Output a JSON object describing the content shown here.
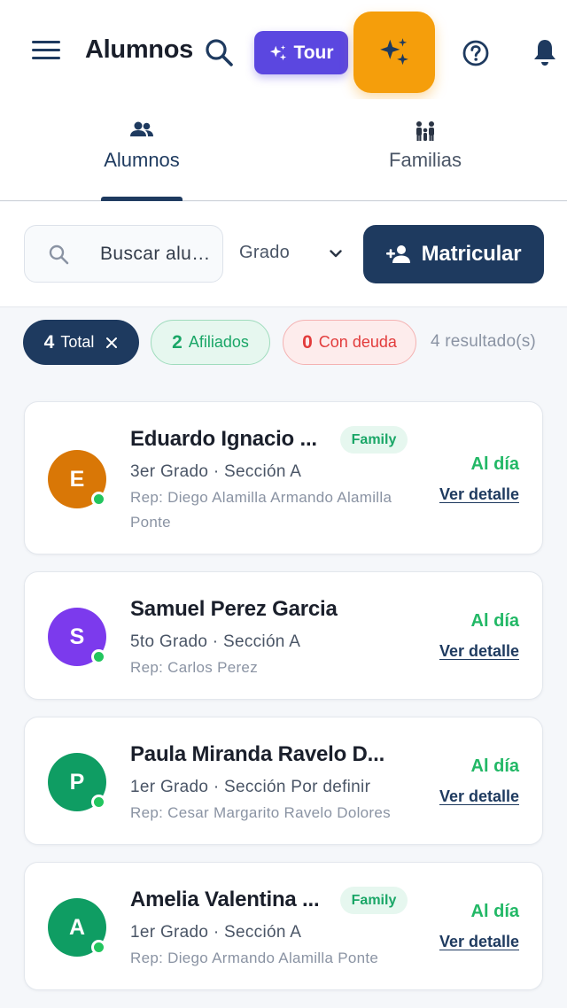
{
  "header": {
    "title": "Alumnos",
    "tour_label": "Tour",
    "icons": [
      "menu-icon",
      "search-icon",
      "sparkles-icon",
      "help-icon",
      "bell-icon"
    ]
  },
  "tabs": [
    {
      "label": "Alumnos",
      "icon": "users-icon",
      "active": true
    },
    {
      "label": "Familias",
      "icon": "family-icon",
      "active": false
    }
  ],
  "filters": {
    "search_placeholder": "Buscar alu…",
    "grade_label": "Grado",
    "enroll_label": "Matricular"
  },
  "chips": {
    "total": {
      "count": "4",
      "label": "Total"
    },
    "afiliados": {
      "count": "2",
      "label": "Afiliados"
    },
    "deuda": {
      "count": "0",
      "label": "Con deuda"
    }
  },
  "results_text": "4 resultado(s)",
  "students": [
    {
      "initial": "E",
      "name": "Eduardo Ignacio ...",
      "badge": "Family",
      "grade": "3er Grado · Sección A",
      "rep": "Rep: Diego Alamilla Armando Alamilla Ponte",
      "status": "Al día",
      "detail": "Ver detalle",
      "avatar_color": "#d97706"
    },
    {
      "initial": "S",
      "name": "Samuel Perez Garcia",
      "badge": "",
      "grade": "5to Grado · Sección A",
      "rep": "Rep: Carlos Perez",
      "status": "Al día",
      "detail": "Ver detalle",
      "avatar_color": "#7c3aed"
    },
    {
      "initial": "P",
      "name": "Paula Miranda Ravelo D...",
      "badge": "",
      "grade": "1er Grado · Sección Por definir",
      "rep": "Rep: Cesar Margarito Ravelo Dolores",
      "status": "Al día",
      "detail": "Ver detalle",
      "avatar_color": "#0f9d63"
    },
    {
      "initial": "A",
      "name": "Amelia Valentina ...",
      "badge": "Family",
      "grade": "1er Grado · Sección A",
      "rep": "Rep: Diego Armando Alamilla Ponte",
      "status": "Al día",
      "detail": "Ver detalle",
      "avatar_color": "#0f9d63"
    }
  ],
  "colors": {
    "primary": "#1e3a5f",
    "tour": "#5b47e0",
    "ai_button": "#f59e0b",
    "success": "#22b866",
    "danger": "#e23b3b"
  }
}
